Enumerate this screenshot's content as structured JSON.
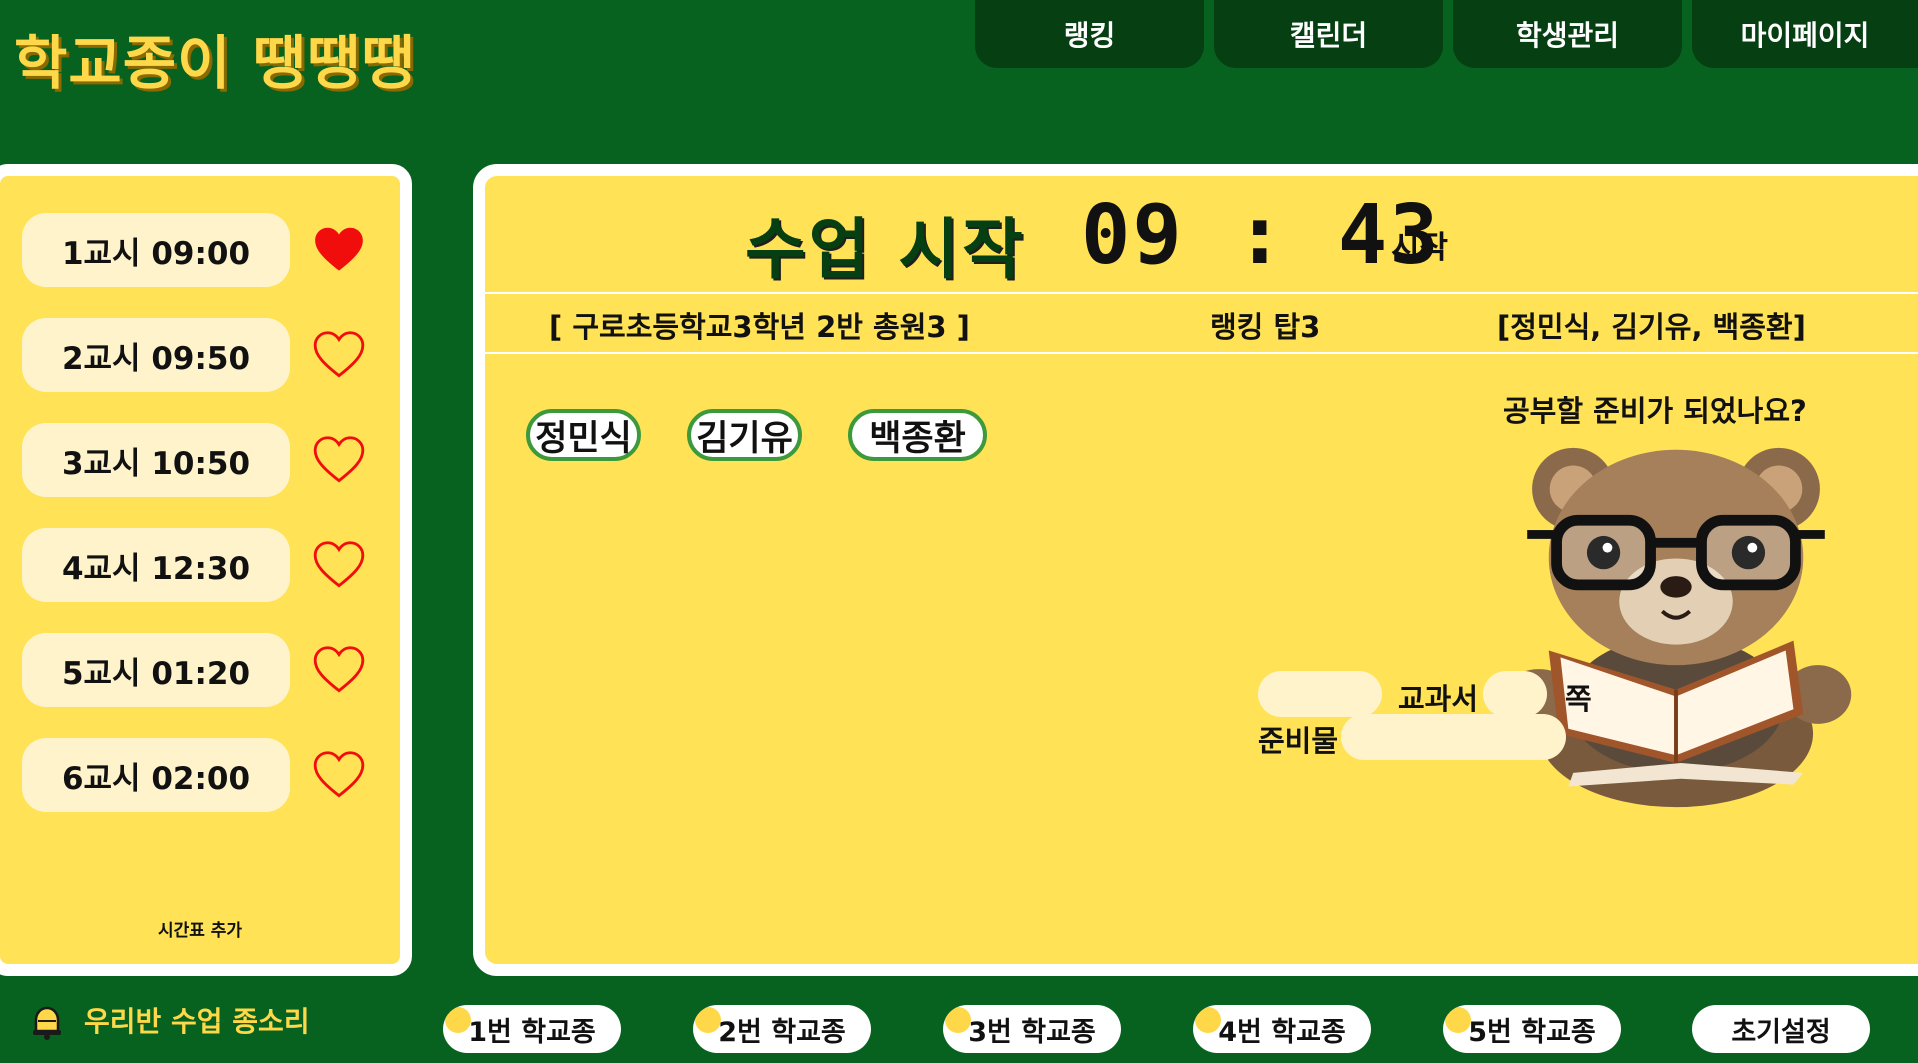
{
  "app": {
    "logo": "학교종이 땡땡땡"
  },
  "nav": {
    "items": [
      "랭킹",
      "캘린더",
      "학생관리",
      "마이페이지"
    ]
  },
  "timetable": {
    "periods": [
      {
        "label": "1교시 09:00",
        "liked": true
      },
      {
        "label": "2교시 09:50",
        "liked": false
      },
      {
        "label": "3교시 10:50",
        "liked": false
      },
      {
        "label": "4교시 12:30",
        "liked": false
      },
      {
        "label": "5교시 01:20",
        "liked": false
      },
      {
        "label": "6교시 02:00",
        "liked": false
      }
    ],
    "add_label": "시간표 추가"
  },
  "main": {
    "title": "수업 시작",
    "clock": "09 : 43",
    "start_label": "시작",
    "school_info": "[ 구로초등학교3학년 2반 총원3 ]",
    "ranking_label": "랭킹 탑3",
    "top3": "[정민식, 김기유, 백종환]",
    "students": [
      "정민식",
      "김기유",
      "백종환"
    ],
    "ready_question": "공부할 준비가 되었나요?",
    "form": {
      "textbook_label": "교과서",
      "page_label": "쪽",
      "supplies_label": "준비물",
      "textbook_value": "",
      "page_value": "",
      "supplies_value": ""
    }
  },
  "footer": {
    "title": "우리반 수업 종소리",
    "buttons": [
      "1번 학교종",
      "2번 학교종",
      "3번 학교종",
      "4번 학교종",
      "5번 학교종",
      "초기설정"
    ]
  },
  "colors": {
    "background": "#07621f",
    "nav_button": "#053f12",
    "panel": "#ffe255",
    "pill": "#fff3cc",
    "accent_yellow": "#ffd84a",
    "heart": "#f20d0d",
    "chip_border": "#3c9a3c"
  },
  "icons": {
    "liked": "heart-filled-icon",
    "unliked": "heart-outline-icon",
    "bell": "bell-icon",
    "mascot": "bear-reading-image"
  }
}
